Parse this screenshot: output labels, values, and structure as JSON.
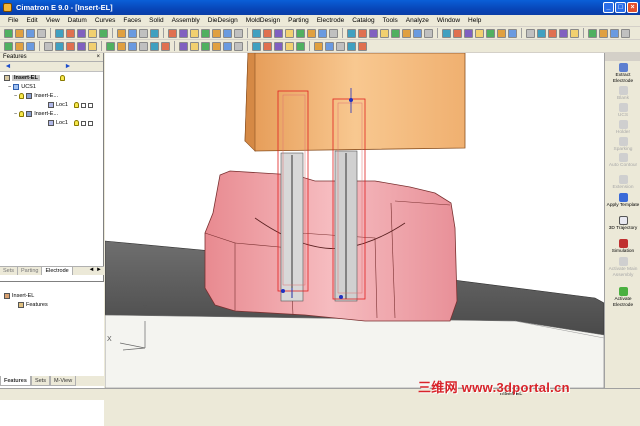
{
  "window": {
    "title": "Cimatron E 9.0 - [Insert-EL]",
    "buttons": [
      "_",
      "□",
      "×"
    ]
  },
  "menu": [
    "File",
    "Edit",
    "View",
    "Datum",
    "Curves",
    "Faces",
    "Solid",
    "Assembly",
    "DieDesign",
    "MoldDesign",
    "Parting",
    "Electrode",
    "Catalog",
    "Tools",
    "Analyze",
    "Window",
    "Help"
  ],
  "left_panel": {
    "title": "Features",
    "close": "×",
    "nav_back": "◄",
    "nav_forward": "►",
    "tree": [
      {
        "label": "Insert-EL",
        "icon": "part-icon",
        "selected": true
      },
      {
        "label": "UCS1",
        "icon": "ucs-icon"
      },
      {
        "label": "Insert-E...",
        "icon": "electrode-icon"
      },
      {
        "label": "Loc1",
        "icon": "location-icon"
      },
      {
        "label": "Insert-E...",
        "icon": "electrode-icon"
      },
      {
        "label": "Loc1",
        "icon": "location-icon"
      }
    ],
    "mid_tabs": [
      "Sets",
      "Parting",
      "Electrode"
    ],
    "mid_active": "Electrode",
    "lower_tree": [
      {
        "label": "Insert-EL",
        "icon": "part-icon"
      },
      {
        "label": "Features",
        "icon": "features-icon"
      }
    ],
    "bottom_tabs": [
      "Features",
      "Sets",
      "M-View"
    ],
    "bottom_active": "Features"
  },
  "right_panel": {
    "buttons": [
      {
        "label": "Extract Electrode",
        "enabled": true
      },
      {
        "label": "Blank",
        "enabled": false
      },
      {
        "label": "UCS",
        "enabled": false
      },
      {
        "label": "Holder",
        "enabled": false
      },
      {
        "label": "Sparking",
        "enabled": false
      },
      {
        "label": "Auto Contour",
        "enabled": false
      },
      {
        "label": "Extension",
        "enabled": false
      },
      {
        "label": "Apply Template",
        "enabled": true
      },
      {
        "label": "3D Trajectory",
        "enabled": true
      },
      {
        "label": "Simulation",
        "enabled": true
      },
      {
        "label": "Activate Main Assembly",
        "enabled": false
      },
      {
        "label": "Activate Electrode",
        "enabled": true
      }
    ]
  },
  "viewport": {
    "axis_labels": {
      "x": "X",
      "z": "Z"
    }
  },
  "status": {
    "right_text": "Insert-EL"
  },
  "watermark": "三维网 www.3dportal.cn",
  "colors": {
    "title_bar": "#0a4fc8",
    "electrode_body": "#f0b070",
    "mold_cavity": "#f2aeb0",
    "selection_wire": "#e02020",
    "watermark": "#d8232a"
  }
}
